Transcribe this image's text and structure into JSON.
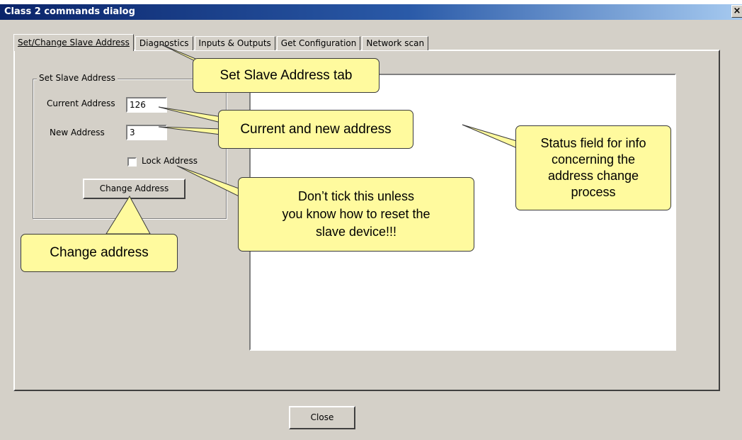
{
  "window": {
    "title": "Class 2 commands dialog",
    "close_glyph": "×"
  },
  "tabs": [
    {
      "label": "Set/Change Slave Address",
      "active": true
    },
    {
      "label": "Diagnostics"
    },
    {
      "label": "Inputs & Outputs"
    },
    {
      "label": "Get Configuration"
    },
    {
      "label": "Network scan"
    }
  ],
  "set_slave": {
    "group_label": "Set Slave Address",
    "current_label": "Current Address",
    "current_value": "126",
    "new_label": "New Address",
    "new_value": "3",
    "lock_label": "Lock Address",
    "lock_checked": false,
    "change_button": "Change Address"
  },
  "close_button": "Close",
  "callouts": {
    "tab": "Set Slave Address tab",
    "address": "Current and new address",
    "status_l1": "Status field for info",
    "status_l2": "concerning the",
    "status_l3": "address change",
    "status_l4": "process",
    "lock_l1": "Don’t tick this unless",
    "lock_l2": "you know how to reset the",
    "lock_l3": "slave device!!!",
    "change": "Change address"
  },
  "colors": {
    "callout_fill": "#fffa9e",
    "dialog_bg": "#d4d0c8",
    "title_bar": "#0a246a"
  }
}
